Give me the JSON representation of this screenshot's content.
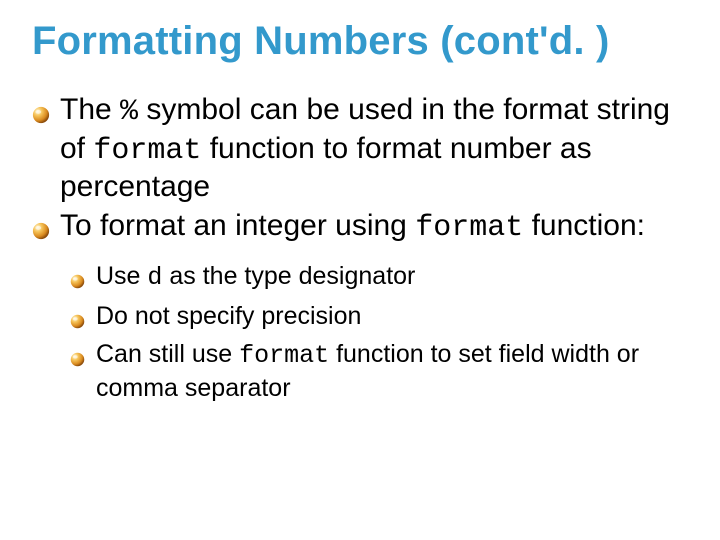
{
  "title": "Formatting Numbers (cont'd. )",
  "b1": {
    "t1": "The ",
    "t2": "%",
    "t3": " symbol can be used in the format string of ",
    "t4": "format",
    "t5": " function to format number as percentage"
  },
  "b2": {
    "t1": "To format an integer using ",
    "t2": "format",
    "t3": " function:"
  },
  "s1": {
    "t1": "Use ",
    "t2": "d",
    "t3": " as the type designator"
  },
  "s2": {
    "t1": "Do not specify precision"
  },
  "s3": {
    "t1": "Can still use ",
    "t2": "format",
    "t3": " function to set field width or comma separator"
  },
  "bullet_svg": {
    "note": "gradient orange sphere bullet"
  }
}
